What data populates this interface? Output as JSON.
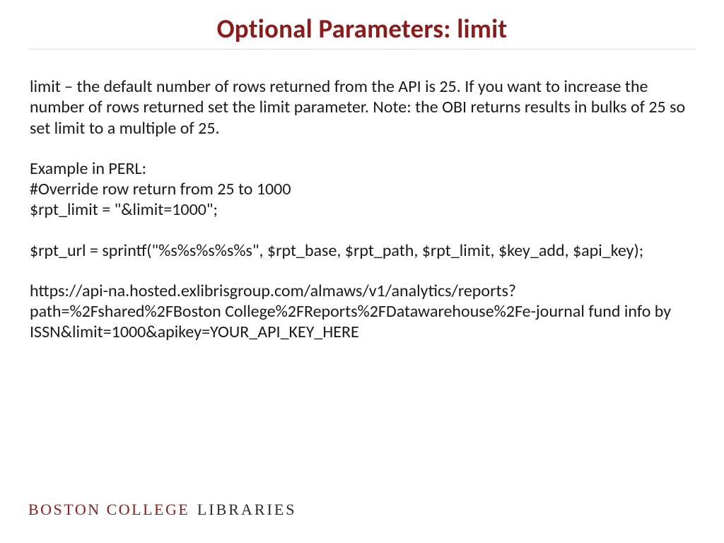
{
  "title": "Optional Parameters: limit",
  "body": {
    "intro": "limit – the default number of rows returned from the API is 25. If you want to increase the number of rows returned set the limit parameter. Note: the OBI returns results in bulks of 25 so set limit to a multiple of 25.",
    "example_label": "Example in PERL:",
    "comment": "#Override row return from 25 to 1000",
    "assign": "$rpt_limit = \"&limit=1000\";",
    "sprintf": "$rpt_url = sprintf(\"%s%s%s%s%s\", $rpt_base, $rpt_path, $rpt_limit, $key_add, $api_key);",
    "url": "https://api-na.hosted.exlibrisgroup.com/almaws/v1/analytics/reports?path=%2Fshared%2FBoston College%2FReports%2FDatawarehouse%2Fe-journal fund info by ISSN&limit=1000&apikey=YOUR_API_KEY_HERE"
  },
  "footer": {
    "bc": "BOSTON COLLEGE",
    "lib": "LIBRARIES"
  }
}
